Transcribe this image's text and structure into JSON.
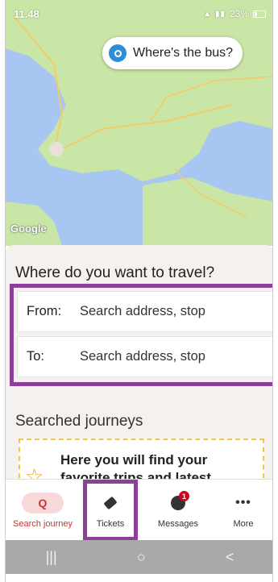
{
  "status_bar": {
    "time": "11.48",
    "battery_percent": "23%"
  },
  "map": {
    "wheres_bus_label": "Where's the bus?",
    "attribution": "Google",
    "colors": {
      "land": "#c9e6a6",
      "water": "#a8c6f2"
    }
  },
  "trip_planner": {
    "title": "Where do you want to travel?",
    "from_label": "From:",
    "from_placeholder": "Search address, stop",
    "to_label": "To:",
    "to_placeholder": "Search address, stop",
    "highlight_color": "#8e3f9a"
  },
  "searched_journeys": {
    "title": "Searched journeys",
    "empty_text": "Here you will find your favorite trips and latest"
  },
  "bottom_nav": {
    "items": [
      {
        "label": "Search journey",
        "icon": "search-icon",
        "active": true
      },
      {
        "label": "Tickets",
        "icon": "ticket-icon"
      },
      {
        "label": "Messages",
        "icon": "messages-icon",
        "badge": "1"
      },
      {
        "label": "More",
        "icon": "more-icon"
      }
    ]
  },
  "system_nav": {
    "recents_icon": "|||",
    "home_icon": "○",
    "back_icon": "<"
  }
}
